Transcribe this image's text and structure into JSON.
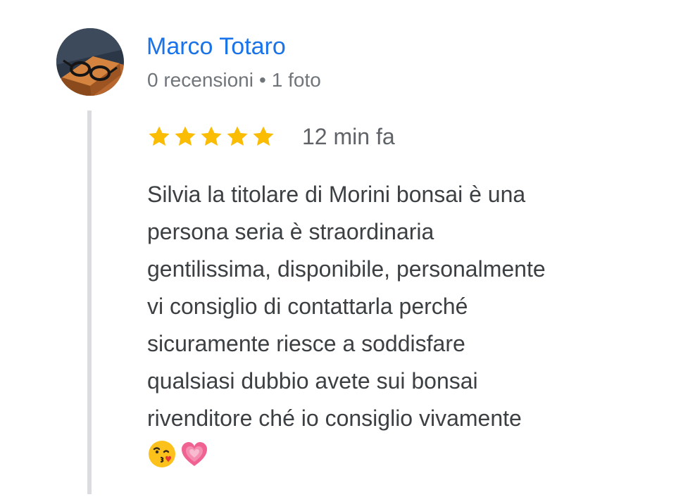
{
  "review": {
    "author": {
      "name": "Marco Totaro",
      "reviews_count": "0 recensioni",
      "separator": "•",
      "photos_count": "1 foto",
      "avatar_icon": "glasses-on-box-avatar"
    },
    "rating": {
      "stars": 5,
      "max_stars": 5,
      "star_color": "#fbbc04"
    },
    "time": "12 min fa",
    "text_lines": [
      "Silvia la titolare di Morini bonsai è una",
      "persona seria è straordinaria",
      "gentilissima, disponibile, personalmente",
      "vi consiglio di contattarla perché",
      "sicuramente riesce a soddisfare",
      "qualsiasi dubbio avete sui bonsai",
      "rivenditore ché io consiglio vivamente"
    ],
    "emojis": [
      "face-blowing-kiss-emoji",
      "growing-heart-emoji"
    ]
  },
  "colors": {
    "author_name": "#1a73e8",
    "meta_text": "#70757a",
    "body_text": "#3c4043",
    "thread_line": "#dadce0"
  }
}
